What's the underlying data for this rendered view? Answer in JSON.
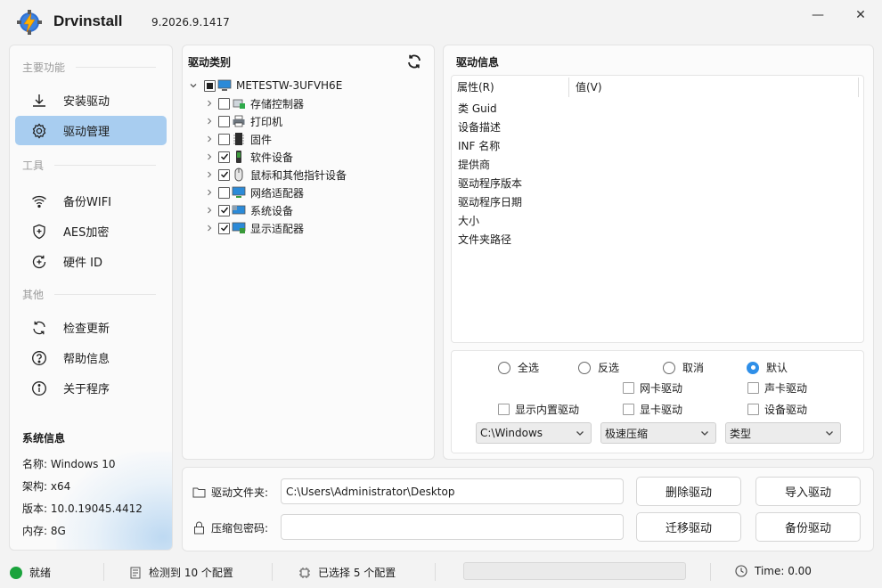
{
  "app": {
    "name": "Drvinstall",
    "version": "9.2026.9.1417"
  },
  "window": {
    "minimize_glyph": "—",
    "close_glyph": "✕"
  },
  "sidebar": {
    "sections": [
      {
        "title": "主要功能"
      },
      {
        "title": "工具"
      },
      {
        "title": "其他"
      }
    ],
    "items": [
      {
        "label": "安装驱动",
        "icon": "download-icon",
        "active": false
      },
      {
        "label": "驱动管理",
        "icon": "gear-icon",
        "active": true
      },
      {
        "label": "备份WIFI",
        "icon": "wifi-icon",
        "active": false
      },
      {
        "label": "AES加密",
        "icon": "shield-icon",
        "active": false
      },
      {
        "label": "硬件 ID",
        "icon": "hardware-id-icon",
        "active": false
      },
      {
        "label": "检查更新",
        "icon": "refresh-icon",
        "active": false
      },
      {
        "label": "帮助信息",
        "icon": "help-icon",
        "active": false
      },
      {
        "label": "关于程序",
        "icon": "info-icon",
        "active": false
      }
    ],
    "sysinfo": {
      "title": "系统信息",
      "rows": [
        "名称: Windows 10",
        "架构: x64",
        "版本: 10.0.19045.4412",
        "内存: 8G"
      ]
    }
  },
  "tree": {
    "title": "驱动类别",
    "root": {
      "label": "METESTW-3UFVH6E",
      "state": "partial"
    },
    "children": [
      {
        "label": "存储控制器",
        "checked": false,
        "icon": "storage-controller-icon"
      },
      {
        "label": "打印机",
        "checked": false,
        "icon": "printer-icon"
      },
      {
        "label": "固件",
        "checked": false,
        "icon": "firmware-icon"
      },
      {
        "label": "软件设备",
        "checked": true,
        "icon": "software-device-icon"
      },
      {
        "label": "鼠标和其他指针设备",
        "checked": true,
        "icon": "mouse-icon"
      },
      {
        "label": "网络适配器",
        "checked": false,
        "icon": "network-adapter-icon"
      },
      {
        "label": "系统设备",
        "checked": true,
        "icon": "system-device-icon"
      },
      {
        "label": "显示适配器",
        "checked": true,
        "icon": "display-adapter-icon"
      }
    ]
  },
  "info": {
    "title": "驱动信息",
    "columns": [
      "属性(R)",
      "值(V)"
    ],
    "properties": [
      "类 Guid",
      "设备描述",
      "INF 名称",
      "提供商",
      "驱动程序版本",
      "驱动程序日期",
      "大小",
      "文件夹路径"
    ]
  },
  "options": {
    "radios": [
      {
        "label": "全选",
        "selected": false
      },
      {
        "label": "反选",
        "selected": false
      },
      {
        "label": "取消",
        "selected": false
      },
      {
        "label": "默认",
        "selected": true
      }
    ],
    "checks": [
      {
        "label": "网卡驱动",
        "checked": false
      },
      {
        "label": "声卡驱动",
        "checked": false
      },
      {
        "label": "显示内置驱动",
        "checked": false
      },
      {
        "label": "显卡驱动",
        "checked": false
      },
      {
        "label": "设备驱动",
        "checked": false
      }
    ],
    "selects": [
      {
        "value": "C:\\Windows"
      },
      {
        "value": "极速压缩"
      },
      {
        "value": "类型"
      }
    ],
    "accent": "#2f8fe8"
  },
  "bottom": {
    "folder_label": "驱动文件夹:",
    "folder_value": "C:\\Users\\Administrator\\Desktop",
    "password_label": "压缩包密码:",
    "password_value": "",
    "buttons": {
      "delete": "删除驱动",
      "import": "导入驱动",
      "migrate": "迁移驱动",
      "backup": "备份驱动"
    }
  },
  "status": {
    "state": "就绪",
    "detected": "检测到 10 个配置",
    "selected": "已选择 5 个配置",
    "progress": 0,
    "time": "Time: 0.00",
    "ok_color": "#1aa33c"
  }
}
